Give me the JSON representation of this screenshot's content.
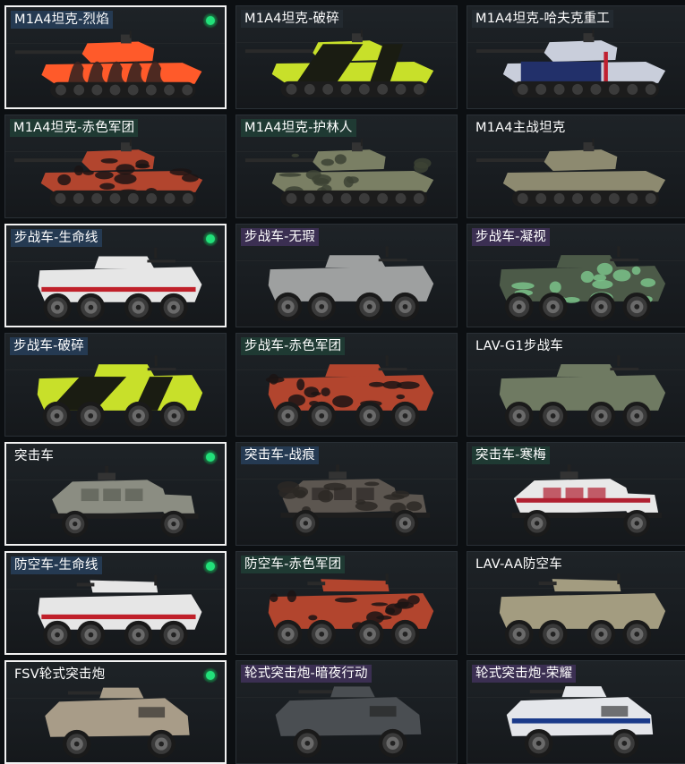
{
  "vehicles": [
    {
      "name": "M1A4坦克-烈焰",
      "type": "tank",
      "tag": "blue",
      "selected": true,
      "equipped": true,
      "primary": "#ff5a2a",
      "accent": "#3a2420",
      "pattern": "flame"
    },
    {
      "name": "M1A4坦克-破碎",
      "type": "tank",
      "tag": "default",
      "selected": false,
      "equipped": false,
      "primary": "#c8e02a",
      "accent": "#1a1c12",
      "pattern": "split"
    },
    {
      "name": "M1A4坦克-哈夫克重工",
      "type": "tank",
      "tag": "default",
      "selected": false,
      "equipped": false,
      "primary": "#c9cedb",
      "accent": "#22306a",
      "pattern": "corp"
    },
    {
      "name": "M1A4坦克-赤色军团",
      "type": "tank",
      "tag": "green",
      "selected": false,
      "equipped": false,
      "primary": "#b2452e",
      "accent": "#1b1414",
      "pattern": "camo"
    },
    {
      "name": "M1A4坦克-护林人",
      "type": "tank",
      "tag": "green",
      "selected": false,
      "equipped": false,
      "primary": "#7a7f64",
      "accent": "#3c4234",
      "pattern": "camo"
    },
    {
      "name": "M1A4主战坦克",
      "type": "tank",
      "tag": "none",
      "selected": false,
      "equipped": false,
      "primary": "#8d8a70",
      "accent": "#55543f",
      "pattern": "plain"
    },
    {
      "name": "步战车-生命线",
      "type": "ifv",
      "tag": "blue",
      "selected": true,
      "equipped": true,
      "primary": "#e6e6e6",
      "accent": "#c0202a",
      "pattern": "stripe"
    },
    {
      "name": "步战车-无瑕",
      "type": "ifv",
      "tag": "purple",
      "selected": false,
      "equipped": false,
      "primary": "#9ea0a0",
      "accent": "#5a5c5c",
      "pattern": "plain"
    },
    {
      "name": "步战车-凝视",
      "type": "ifv",
      "tag": "purple",
      "selected": false,
      "equipped": false,
      "primary": "#4c5a48",
      "accent": "#7ac28a",
      "pattern": "camo"
    },
    {
      "name": "步战车-破碎",
      "type": "ifv",
      "tag": "blue",
      "selected": false,
      "equipped": false,
      "primary": "#c8e02a",
      "accent": "#1a1c12",
      "pattern": "split"
    },
    {
      "name": "步战车-赤色军团",
      "type": "ifv",
      "tag": "green",
      "selected": false,
      "equipped": false,
      "primary": "#b2452e",
      "accent": "#1b1414",
      "pattern": "camo"
    },
    {
      "name": "LAV-G1步战车",
      "type": "ifv",
      "tag": "none",
      "selected": false,
      "equipped": false,
      "primary": "#6f7a62",
      "accent": "#4a5242",
      "pattern": "plain"
    },
    {
      "name": "突击车",
      "type": "mrap",
      "tag": "none",
      "selected": true,
      "equipped": true,
      "primary": "#8b8d82",
      "accent": "#5a5c53",
      "pattern": "plain"
    },
    {
      "name": "突击车-战痕",
      "type": "mrap",
      "tag": "blue",
      "selected": false,
      "equipped": false,
      "primary": "#5c5650",
      "accent": "#2c2825",
      "pattern": "camo"
    },
    {
      "name": "突击车-寒梅",
      "type": "mrap",
      "tag": "green",
      "selected": false,
      "equipped": false,
      "primary": "#e8e8e8",
      "accent": "#b02030",
      "pattern": "stripe"
    },
    {
      "name": "防空车-生命线",
      "type": "aa",
      "tag": "blue",
      "selected": true,
      "equipped": true,
      "primary": "#e6e6e6",
      "accent": "#c0202a",
      "pattern": "stripe"
    },
    {
      "name": "防空车-赤色军团",
      "type": "aa",
      "tag": "green",
      "selected": false,
      "equipped": false,
      "primary": "#b2452e",
      "accent": "#1b1414",
      "pattern": "camo"
    },
    {
      "name": "LAV-AA防空车",
      "type": "aa",
      "tag": "none",
      "selected": false,
      "equipped": false,
      "primary": "#a39c80",
      "accent": "#6a6552",
      "pattern": "plain"
    },
    {
      "name": "FSV轮式突击炮",
      "type": "fsv",
      "tag": "none",
      "selected": true,
      "equipped": true,
      "primary": "#a89c88",
      "accent": "#6c6456",
      "pattern": "plain"
    },
    {
      "name": "轮式突击炮-暗夜行动",
      "type": "fsv",
      "tag": "purple",
      "selected": false,
      "equipped": false,
      "primary": "#4a4e52",
      "accent": "#202326",
      "pattern": "plain"
    },
    {
      "name": "轮式突击炮-荣耀",
      "type": "fsv",
      "tag": "purple",
      "selected": false,
      "equipped": false,
      "primary": "#e4e6ea",
      "accent": "#1a3a8a",
      "pattern": "stripe"
    }
  ],
  "equipped_icon": "equipped-dot-icon"
}
